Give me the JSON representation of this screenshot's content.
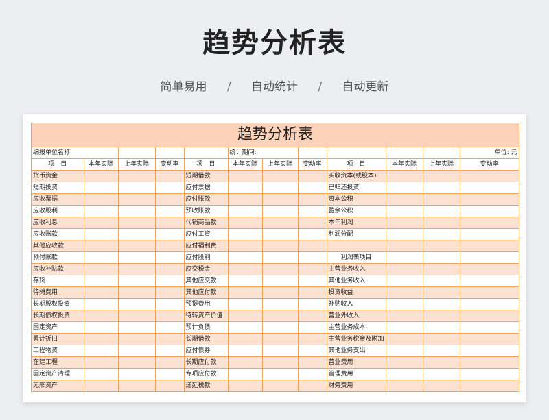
{
  "hero": {
    "title": "趋势分析表",
    "tags": [
      "简单易用",
      "自动统计",
      "自动更新"
    ],
    "separator": "/"
  },
  "sheet": {
    "title": "趋势分析表",
    "info": {
      "unit_label": "编报单位名称:",
      "period_label": "统计期间:",
      "currency_label": "单位:",
      "currency_value": "元"
    },
    "headers": [
      "项　目",
      "本年实际",
      "上年实际",
      "变动率",
      "项　目",
      "本年实际",
      "上年实际",
      "变动率",
      "项　目",
      "本年实际",
      "上年实际",
      "变动率"
    ],
    "colors": {
      "border": "#f2a15a",
      "shade": "#fde2d1",
      "title_bg": "#fcd2b8"
    },
    "rows": [
      [
        "货币资金",
        "短期借款",
        "实收资本(或股本)"
      ],
      [
        "短期投资",
        "应付票据",
        "已归还投资"
      ],
      [
        "应收票据",
        "应付账款",
        "资本公积"
      ],
      [
        "应收股利",
        "预收账款",
        "盈余公积"
      ],
      [
        "应收利息",
        "代销商品款",
        "本年利润"
      ],
      [
        "应收账款",
        "应付工资",
        "利润分配"
      ],
      [
        "其他应收款",
        "应付福利费",
        ""
      ],
      [
        "预付账款",
        "应付股利",
        "利润表项目"
      ],
      [
        "应收补贴款",
        "应交税金",
        "主营业务收入"
      ],
      [
        "存货",
        "其他应交款",
        "其他业务收入"
      ],
      [
        "待摊费用",
        "其他应付款",
        "投资收益"
      ],
      [
        "长期股权投资",
        "预提费用",
        "补贴收入"
      ],
      [
        "长期债权投资",
        "待转资产价值",
        "营业外收入"
      ],
      [
        "固定资产",
        "预计负债",
        "主营业务成本"
      ],
      [
        "累计折旧",
        "长期借款",
        "主营业务税金及附加"
      ],
      [
        "工程物资",
        "应付债券",
        "其他业务支出"
      ],
      [
        "在建工程",
        "长期应付款",
        "营业费用"
      ],
      [
        "固定资产清理",
        "专项应付款",
        "管理费用"
      ],
      [
        "无形资产",
        "递延税款",
        "财务费用"
      ]
    ]
  }
}
